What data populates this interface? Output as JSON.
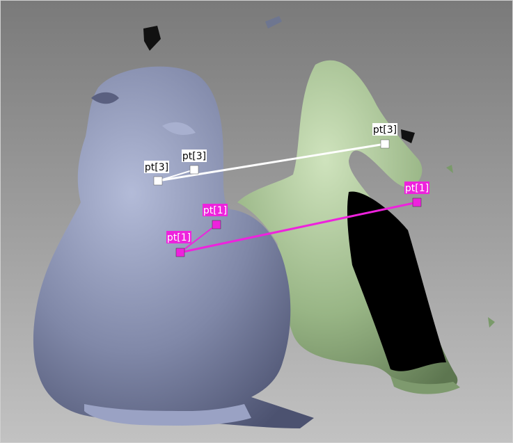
{
  "viewer": {
    "background_top": "#7d7d7d",
    "background_bottom": "#bebebe",
    "models": [
      {
        "name": "source-mesh",
        "color": "#8a93b3"
      },
      {
        "name": "target-mesh",
        "color": "#9fbc8e"
      }
    ]
  },
  "correspondences": [
    {
      "id": "pt3",
      "color": "#ffffff",
      "source_label": "pt[3]",
      "source_alt_label": "pt[3]",
      "target_label": "pt[3]"
    },
    {
      "id": "pt1",
      "color": "#ee22dd",
      "source_label": "pt[1]",
      "source_alt_label": "pt[1]",
      "target_label": "pt[1]"
    }
  ]
}
